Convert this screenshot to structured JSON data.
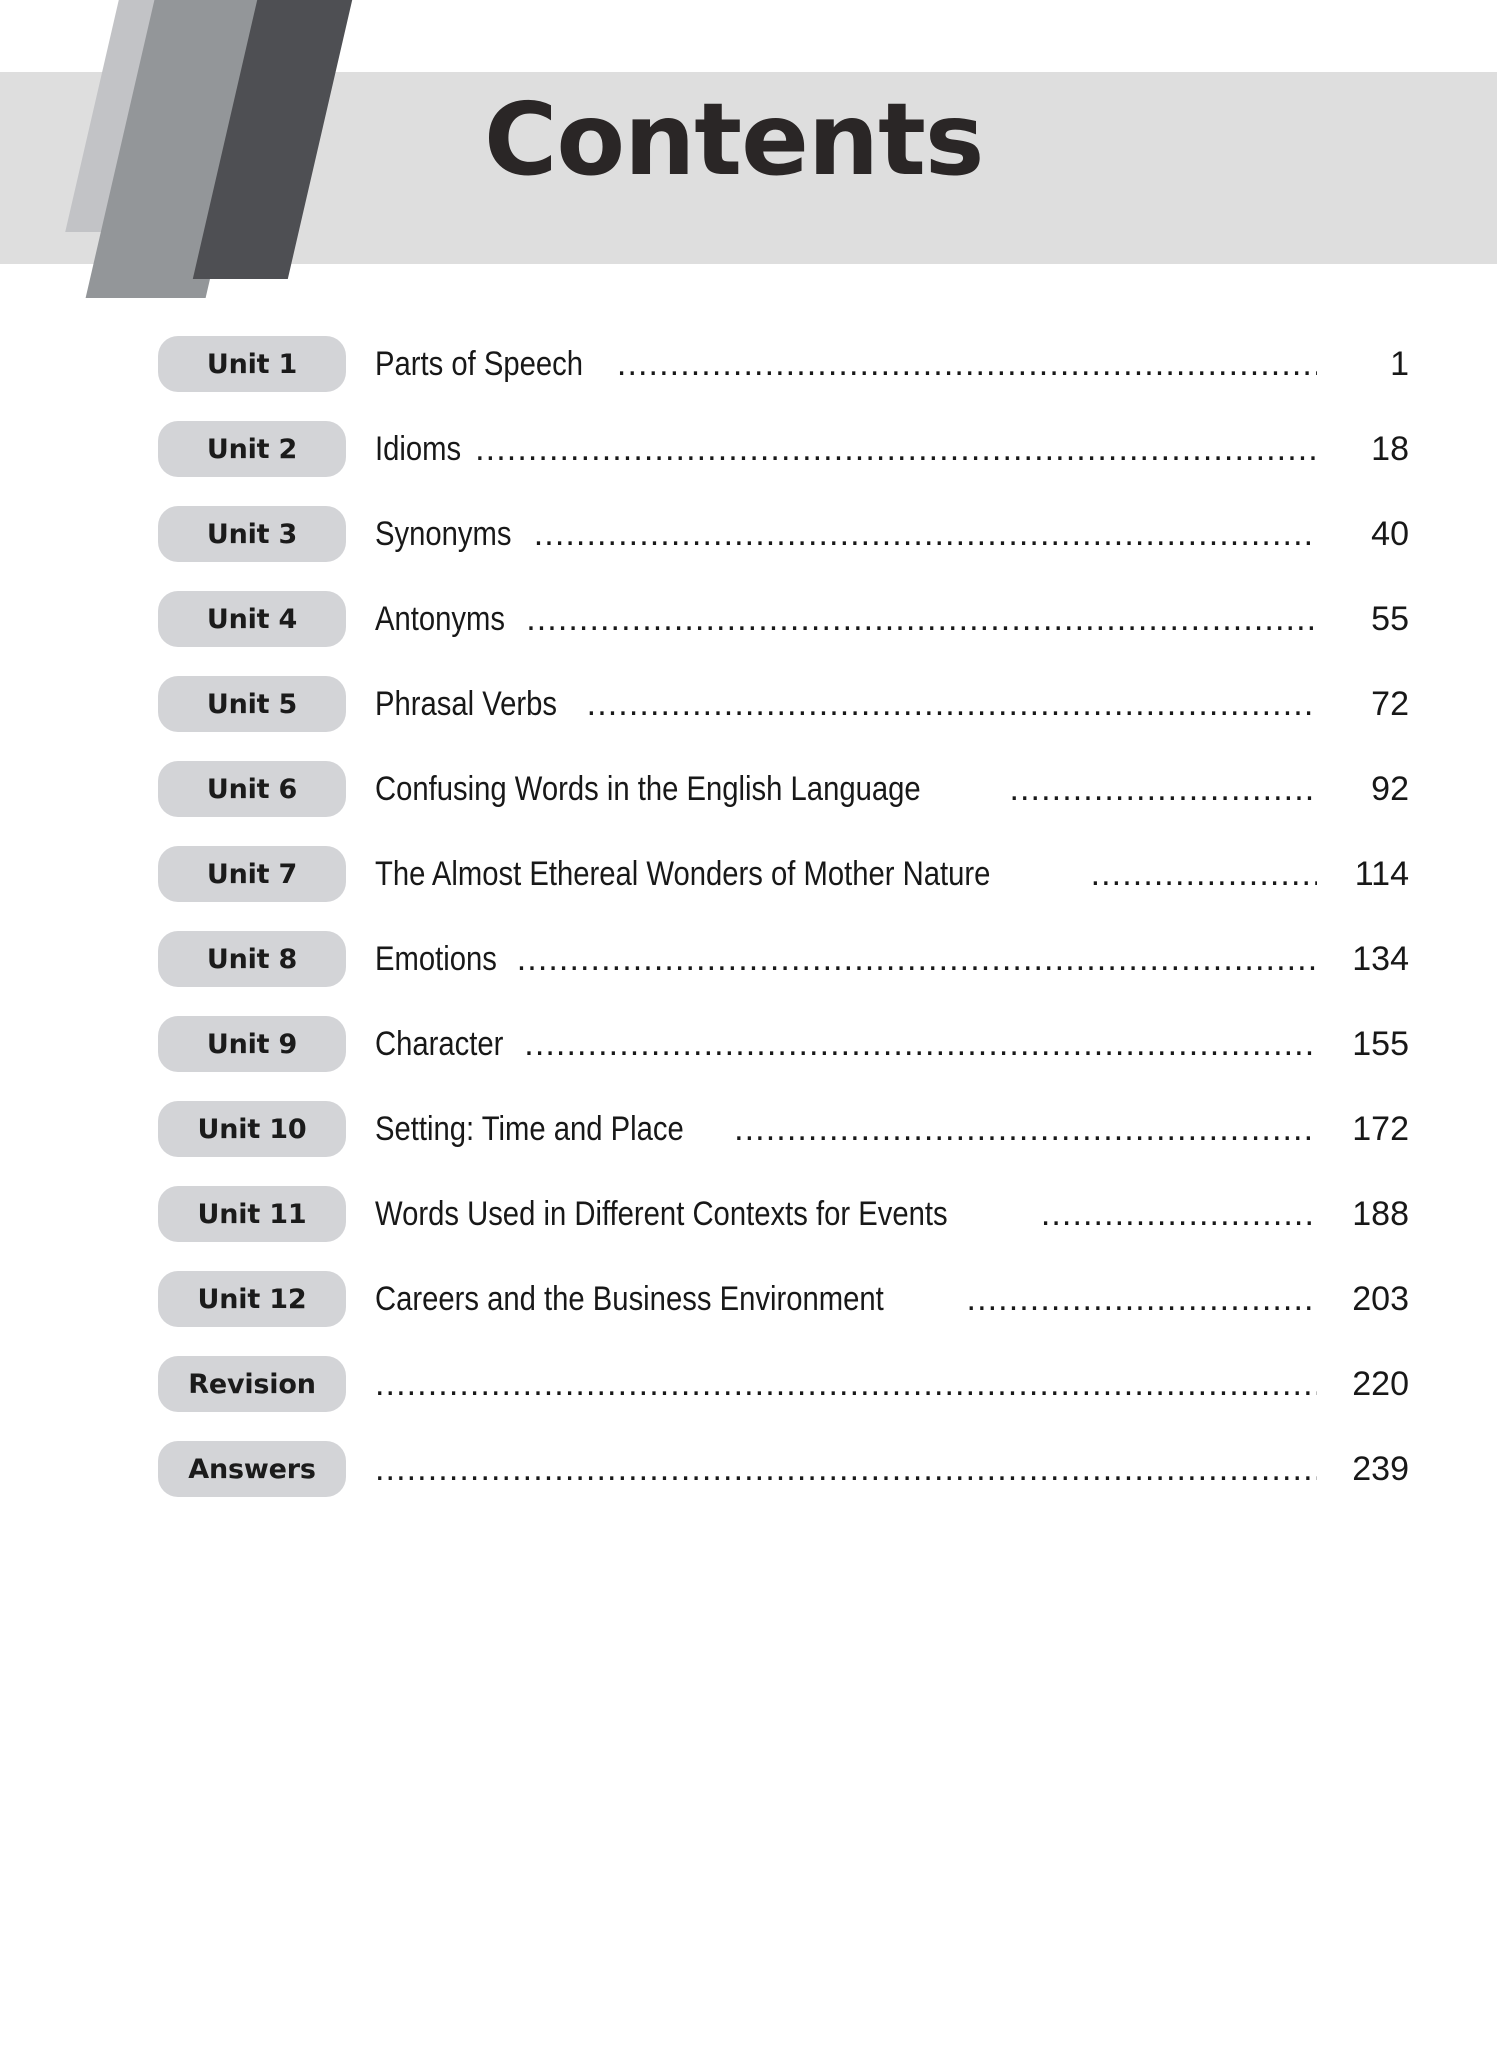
{
  "header": {
    "title": "Contents",
    "banner_color": "#dedede",
    "chevron_colors": [
      "#c2c3c6",
      "#939699",
      "#4e4f53"
    ]
  },
  "toc": {
    "pill_color": "#d3d4d7",
    "leader_char": ".",
    "rows": [
      {
        "unit": "Unit 1",
        "title": "Parts of Speech",
        "page": "1"
      },
      {
        "unit": "Unit 2",
        "title": "Idioms",
        "page": "18"
      },
      {
        "unit": "Unit 3",
        "title": "Synonyms",
        "page": "40"
      },
      {
        "unit": "Unit 4",
        "title": "Antonyms",
        "page": "55"
      },
      {
        "unit": "Unit 5",
        "title": "Phrasal Verbs",
        "page": "72"
      },
      {
        "unit": "Unit 6",
        "title": "Confusing Words in the English Language",
        "page": "92"
      },
      {
        "unit": "Unit 7",
        "title": "The Almost Ethereal Wonders of Mother Nature",
        "page": "114"
      },
      {
        "unit": "Unit 8",
        "title": "Emotions",
        "page": "134"
      },
      {
        "unit": "Unit 9",
        "title": "Character",
        "page": "155"
      },
      {
        "unit": "Unit 10",
        "title": "Setting: Time and Place",
        "page": "172"
      },
      {
        "unit": "Unit 11",
        "title": "Words Used in Different Contexts for Events",
        "page": "188"
      },
      {
        "unit": "Unit 12",
        "title": "Careers and the Business Environment",
        "page": "203"
      },
      {
        "unit": "Revision",
        "title": "",
        "page": "220"
      },
      {
        "unit": "Answers",
        "title": "",
        "page": "239"
      }
    ]
  }
}
